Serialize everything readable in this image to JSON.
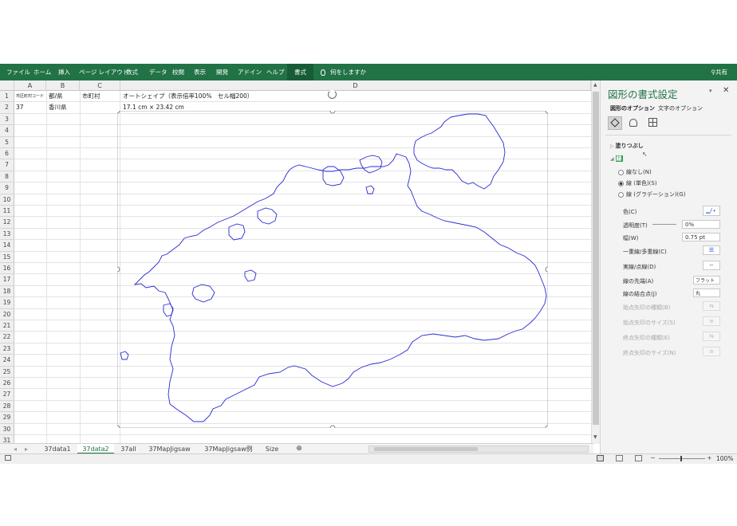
{
  "ribbon": {
    "tabs": [
      "ファイル",
      "ホーム",
      "挿入",
      "ページ レイアウト",
      "数式",
      "データ",
      "校閲",
      "表示",
      "開発",
      "アドイン",
      "ヘルプ"
    ],
    "active_tab": "書式",
    "tell_me": "何をしますか",
    "share": "共有",
    "bg_color": "#217346"
  },
  "columns": [
    "A",
    "B",
    "C",
    "D"
  ],
  "rows": [
    "1",
    "2",
    "3",
    "4",
    "5",
    "6",
    "7",
    "8",
    "9",
    "10",
    "11",
    "12",
    "13",
    "14",
    "15",
    "16",
    "17",
    "18",
    "19",
    "20",
    "21",
    "22",
    "23",
    "24",
    "25",
    "26",
    "27",
    "28",
    "29",
    "30",
    "31"
  ],
  "cells": {
    "a1": "市区町村コード",
    "b1": "都/県",
    "c1": "市町村",
    "d1": "オートシェイプ（表示倍率100%　セル幅200）",
    "a2": "37",
    "b2": "香川県",
    "d2": "17.1 cm × 23.42 cm"
  },
  "shape": {
    "outline_color": "#2a2ad4"
  },
  "pane": {
    "title": "図形の書式設定",
    "tab_shape": "図形のオプション",
    "tab_text": "文字のオプション",
    "icons": [
      "fill-line-icon",
      "effects-icon",
      "size-properties-icon"
    ],
    "fill_section": "塗りつぶし",
    "line_section": "線",
    "radios": [
      "線なし(N)",
      "線 (単色)(S)",
      "線 (グラデーション)(G)"
    ],
    "color_label": "色(C)",
    "transparency_label": "透明度(T)",
    "transparency_value": "0%",
    "width_label": "幅(W)",
    "width_value": "0.75 pt",
    "compound_label": "一重線/多重線(C)",
    "dash_label": "実線/点線(D)",
    "cap_label": "線の先端(A)",
    "cap_value": "フラット",
    "join_label": "線の結合点(J)",
    "join_value": "丸",
    "begin_arrow_type": "始点矢印の種類(B)",
    "begin_arrow_size": "始点矢印のサイズ(S)",
    "end_arrow_type": "終点矢印の種類(E)",
    "end_arrow_size": "終点矢印のサイズ(N)"
  },
  "sheets": [
    "37data1",
    "37data2",
    "37all",
    "37MapJigsaw",
    "37MapJigsaw例",
    "Size"
  ],
  "active_sheet": "37data2",
  "status": {
    "zoom": "100%"
  }
}
